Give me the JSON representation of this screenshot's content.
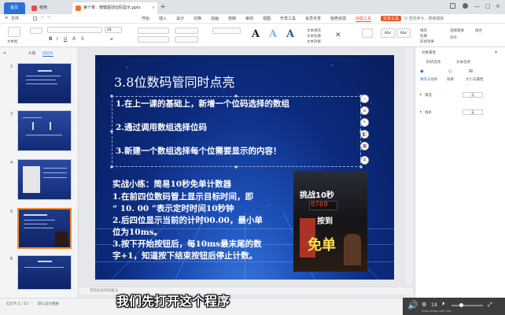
{
  "tabs": {
    "home": "首页",
    "shell": "稻壳",
    "doc": "第十章：按键驱动位码显示.pptx"
  },
  "menu": {
    "file": "文件",
    "items": [
      "开始",
      "插入",
      "设计",
      "切换",
      "动画",
      "放映",
      "审阅",
      "视图",
      "开发工具",
      "会员专享",
      "稻壳资源",
      "绘图工具",
      "文本工具"
    ],
    "search": "Q 查找命令、搜索模板"
  },
  "ribbon": {
    "textbox": "文本框",
    "font_size": "24",
    "text_fill": "文本填充",
    "text_outline": "文本轮廓",
    "text_effect": "文本效果",
    "shape_fill": "填充",
    "shape_outline": "轮廓",
    "shape_effect": "形状效果",
    "select_pane": "选择窗格",
    "align": "对齐",
    "group": "组合"
  },
  "left_panel": {
    "outline_tab": "大纲",
    "slides_tab": "幻灯片",
    "slide_numbers": [
      "2",
      "3",
      "4",
      "5",
      "6"
    ]
  },
  "slide": {
    "title": "3.8位数码管同时点亮",
    "items": [
      "1.在上一课的基础上，新增一个位码选择的数组",
      "2.通过调用数组选择位码",
      "3.新建一个数组选择每个位需要显示的内容！"
    ],
    "exercise": [
      "实战小练：简易10秒免单计数器",
      "1.在前四位数码管上显示目标时间，即",
      "“ 10. 00 ”表示定时时间10秒钟",
      "2.后四位显示当前的计时00.00，最小单",
      "位为10ms。",
      "3.按下开始按钮后，每10ms最末尾的数",
      "字+1，知道按下结束按钮后停止计数。"
    ],
    "photo_text": {
      "top": "挑战10秒",
      "digits": "0769",
      "press": "按到",
      "free": "免单"
    }
  },
  "notes_placeholder": "单击此处添加备注",
  "right_panel": {
    "title": "对象属性",
    "tabs": [
      "形状选项",
      "文本选项"
    ],
    "sub_tabs": [
      "填充与线条",
      "效果",
      "大小与属性"
    ],
    "fill_label": "填充",
    "fill_value": "无",
    "line_label": "线条",
    "line_value": "无"
  },
  "status": {
    "slide_info": "幻灯片 5 / 15",
    "theme": "默认设计模板"
  },
  "subtitle": "我们先打开这个程序",
  "video": {
    "zoom": "1X",
    "watermark": "https://blog.csdn.net/..."
  },
  "colors": {
    "accent": "#2f6fd8",
    "active_menu": "#e85a2a",
    "selection": "#f08a2a"
  }
}
